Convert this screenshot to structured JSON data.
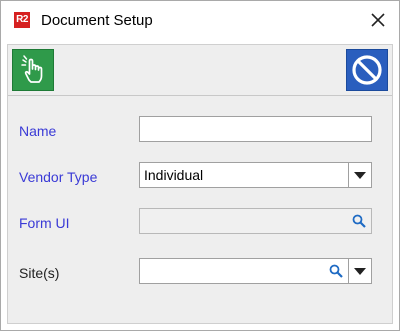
{
  "window": {
    "title": "Document Setup",
    "app_logo_text": "R2",
    "close_icon": "close-icon"
  },
  "toolbar": {
    "ok_icon": "hand-pointer-icon",
    "cancel_icon": "prohibited-icon",
    "ok_color": "#2f9a4a",
    "cancel_color": "#2a5ebe"
  },
  "form": {
    "name": {
      "label": "Name",
      "value": ""
    },
    "vendor_type": {
      "label": "Vendor Type",
      "value": "Individual"
    },
    "form_ui": {
      "label": "Form UI",
      "value": "",
      "icon": "search-icon"
    },
    "sites": {
      "label": "Site(s)",
      "value": "",
      "icon": "search-icon"
    }
  },
  "colors": {
    "required_label": "#3a3ad6",
    "optional_label": "#222222"
  }
}
